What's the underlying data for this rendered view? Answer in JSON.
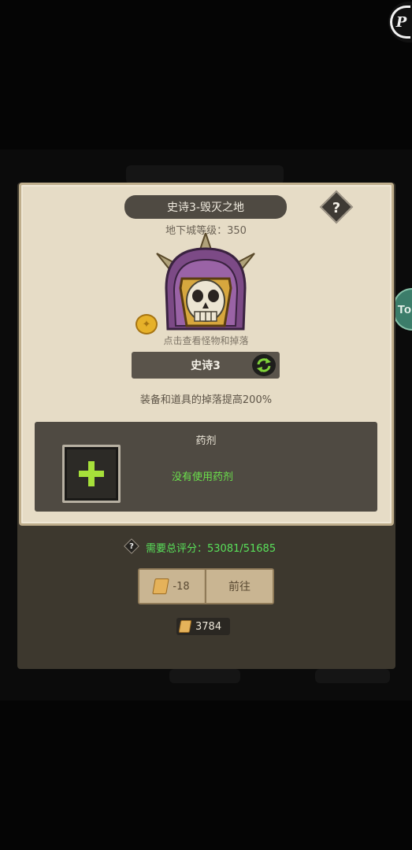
{
  "overlay": {
    "corner_logo_letter": "P",
    "side_tab_text": "To"
  },
  "dungeon": {
    "title": "史诗3-毁灭之地",
    "level_text": "地下城等级：350",
    "help_label": "?",
    "tap_hint": "点击查看怪物和掉落",
    "difficulty": "史诗3",
    "drop_bonus": "装备和道具的掉落提高200%"
  },
  "potion": {
    "title": "药剂",
    "status": "没有使用药剂"
  },
  "requirement": {
    "icon_label": "?",
    "text": "需要总评分：53081/51685"
  },
  "actions": {
    "cost": "-18",
    "go_label": "前往"
  },
  "tickets": {
    "count": "3784"
  },
  "colors": {
    "paper": "#e6dcc6",
    "panel": "#4f4a42",
    "green_text": "#59e05a",
    "plus_green": "#a6e03a"
  }
}
